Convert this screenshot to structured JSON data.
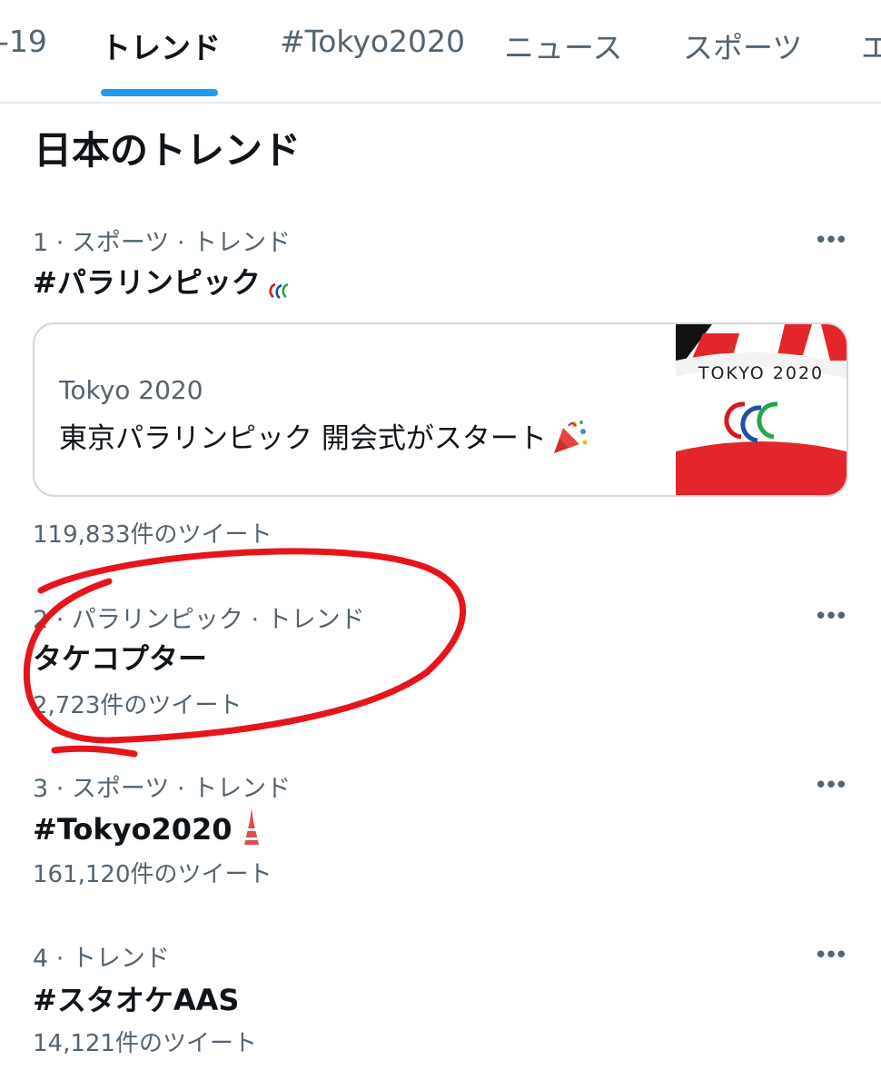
{
  "tabs": [
    {
      "label": "-19"
    },
    {
      "label": "トレンド",
      "active": true
    },
    {
      "label": "#Tokyo2020"
    },
    {
      "label": "ニュース"
    },
    {
      "label": "スポーツ"
    },
    {
      "label": "エ"
    }
  ],
  "section_title": "日本のトレンド",
  "more_label": "•••",
  "trends": [
    {
      "meta": "1 · スポーツ · トレンド",
      "name": "#パラリンピック",
      "count": "119,833件のツイート"
    },
    {
      "meta": "2 · パラリンピック · トレンド",
      "name": "タケコプター",
      "count": "2,723件のツイート"
    },
    {
      "meta": "3 · スポーツ · トレンド",
      "name": "#Tokyo2020",
      "count": "161,120件のツイート"
    },
    {
      "meta": "4 · トレンド",
      "name": "#スタオケAAS",
      "count": "14,121件のツイート"
    }
  ],
  "card": {
    "source": "Tokyo 2020",
    "headline": "東京パラリンピック 開会式がスタート",
    "thumbnail_text": "TOKYO 2020"
  },
  "colors": {
    "accent": "#1d9bf0",
    "text_primary": "#0f1419",
    "text_secondary": "#536471",
    "border": "#cfd9de",
    "annotation_red": "#e8141c"
  },
  "icons": {
    "paralympics": "paralympics-agitos-icon",
    "tower": "tokyo-tower-icon",
    "popper": "party-popper-icon",
    "more": "more-dots-icon"
  }
}
